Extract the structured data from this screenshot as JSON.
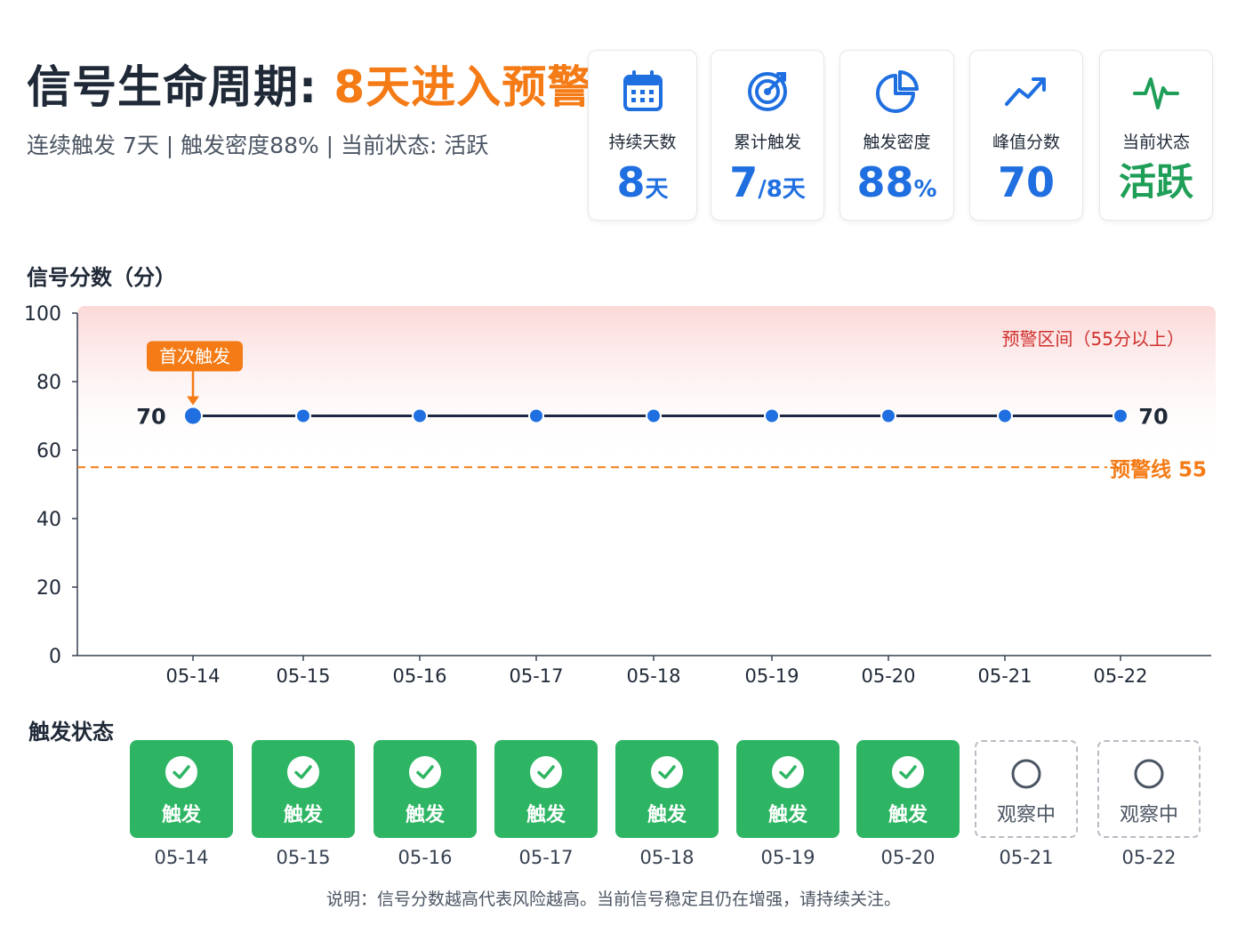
{
  "header": {
    "title_main": "信号生命周期:",
    "title_accent": "8天进入预警",
    "subtitle": "连续触发 7天 | 触发密度88% | 当前状态: 活跃"
  },
  "cards": [
    {
      "icon": "calendar-icon",
      "label": "持续天数",
      "value": "8",
      "unit": "天"
    },
    {
      "icon": "target-icon",
      "label": "累计触发",
      "value": "7",
      "unit": "/8天"
    },
    {
      "icon": "pie-chart-icon",
      "label": "触发密度",
      "value": "88",
      "unit": "%"
    },
    {
      "icon": "trending-up-icon",
      "label": "峰值分数",
      "value": "70",
      "unit": ""
    },
    {
      "icon": "pulse-icon",
      "label": "当前状态",
      "value": "活跃",
      "unit": ""
    }
  ],
  "chart_section_title": "信号分数（分）",
  "chart_data": {
    "type": "line",
    "ylabel": "信号分数（分）",
    "x": [
      "05-14",
      "05-15",
      "05-16",
      "05-17",
      "05-18",
      "05-19",
      "05-20",
      "05-21",
      "05-22"
    ],
    "series": [
      {
        "values": [
          70,
          70,
          70,
          70,
          70,
          70,
          70,
          70,
          70
        ]
      }
    ],
    "ylim": [
      0,
      100
    ],
    "yticks": [
      0,
      20,
      40,
      60,
      80,
      100
    ],
    "grid": false,
    "warning_zone": {
      "from": 55,
      "to": 100,
      "label": "预警区间（55分以上）"
    },
    "threshold": {
      "value": 55,
      "label": "预警线",
      "value_label": "55"
    },
    "annotations": [
      {
        "x": "05-14",
        "text": "首次触发"
      }
    ],
    "point_labels": [
      {
        "x": "05-14",
        "text": "70"
      },
      {
        "x": "05-22",
        "text": "70"
      }
    ]
  },
  "status_section_title": "触发状态",
  "status": [
    {
      "date": "05-14",
      "state": "触发",
      "active": true
    },
    {
      "date": "05-15",
      "state": "触发",
      "active": true
    },
    {
      "date": "05-16",
      "state": "触发",
      "active": true
    },
    {
      "date": "05-17",
      "state": "触发",
      "active": true
    },
    {
      "date": "05-18",
      "state": "触发",
      "active": true
    },
    {
      "date": "05-19",
      "state": "触发",
      "active": true
    },
    {
      "date": "05-20",
      "state": "触发",
      "active": true
    },
    {
      "date": "05-21",
      "state": "观察中",
      "active": false
    },
    {
      "date": "05-22",
      "state": "观察中",
      "active": false
    }
  ],
  "note": "说明：信号分数越高代表风险越高。当前信号稳定且仍在增强，请持续关注。",
  "colors": {
    "accent": "#f47b16",
    "blue": "#1f6fe0",
    "green": "#2eb563",
    "navy": "#1e2a44",
    "warning_red": "#d0312d"
  }
}
